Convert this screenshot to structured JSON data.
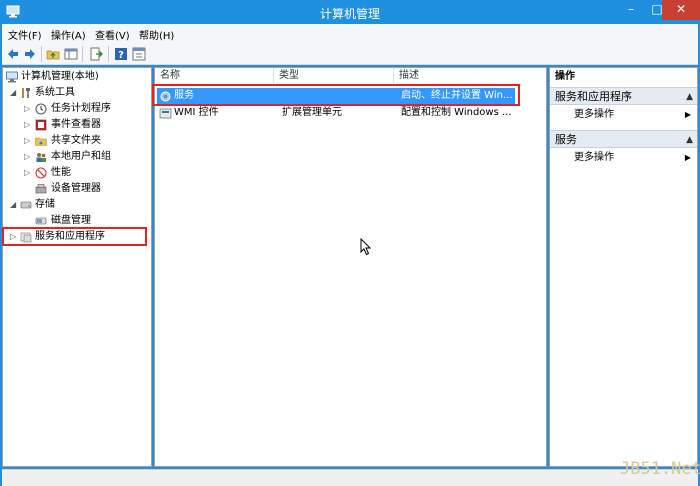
{
  "window": {
    "title": "计算机管理",
    "minimize_label": "–",
    "maximize_label": "□",
    "close_label": "✕"
  },
  "menu": [
    {
      "label": "文件(F)"
    },
    {
      "label": "操作(A)"
    },
    {
      "label": "查看(V)"
    },
    {
      "label": "帮助(H)"
    }
  ],
  "toolbar": {
    "icons": [
      "back-icon",
      "forward-icon",
      "up-folder-icon",
      "show-hide-tree-icon",
      "export-icon",
      "help-icon",
      "properties-icon"
    ]
  },
  "tree": {
    "root": "计算机管理(本地)",
    "system_tools": "系统工具",
    "task_scheduler": "任务计划程序",
    "event_viewer": "事件查看器",
    "shared_folders": "共享文件夹",
    "local_users": "本地用户和组",
    "performance": "性能",
    "device_manager": "设备管理器",
    "storage": "存储",
    "disk_management": "磁盘管理",
    "services_apps": "服务和应用程序"
  },
  "list": {
    "columns": {
      "name": "名称",
      "type": "类型",
      "desc": "描述"
    },
    "rows": [
      {
        "name": "服务",
        "type": "",
        "desc": "启动、终止并设置 Win..."
      },
      {
        "name": "WMI 控件",
        "type": "扩展管理单元",
        "desc": "配置和控制 Windows ..."
      }
    ]
  },
  "actions": {
    "header": "操作",
    "section1": "服务和应用程序",
    "section1_more": "更多操作",
    "section2": "服务",
    "section2_more": "更多操作"
  },
  "watermark": "JB51.Net",
  "colors": {
    "titlebar": "#1f8fe0",
    "close_button": "#c84031",
    "selection": "#3399ff",
    "highlight_box": "#e02424"
  }
}
